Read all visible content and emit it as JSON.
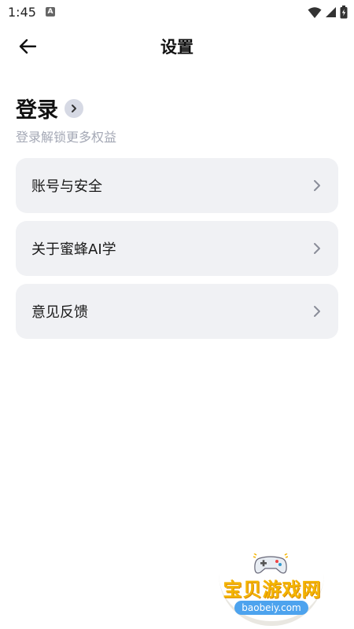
{
  "status_bar": {
    "time": "1:45",
    "notification_letter": "A"
  },
  "app_bar": {
    "title": "设置"
  },
  "login": {
    "title": "登录",
    "subtitle": "登录解锁更多权益"
  },
  "menu": {
    "items": [
      {
        "label": "账号与安全"
      },
      {
        "label": "关于蜜蜂AI学"
      },
      {
        "label": "意见反馈"
      }
    ]
  },
  "watermark": {
    "title": "宝贝游戏网",
    "url": "baobeiy.com"
  },
  "colors": {
    "background": "#ffffff",
    "card": "#f0f1f4",
    "subtitle": "#a4a8b5",
    "chevron": "#8a8d99",
    "login_chip": "#d6d9e4"
  }
}
